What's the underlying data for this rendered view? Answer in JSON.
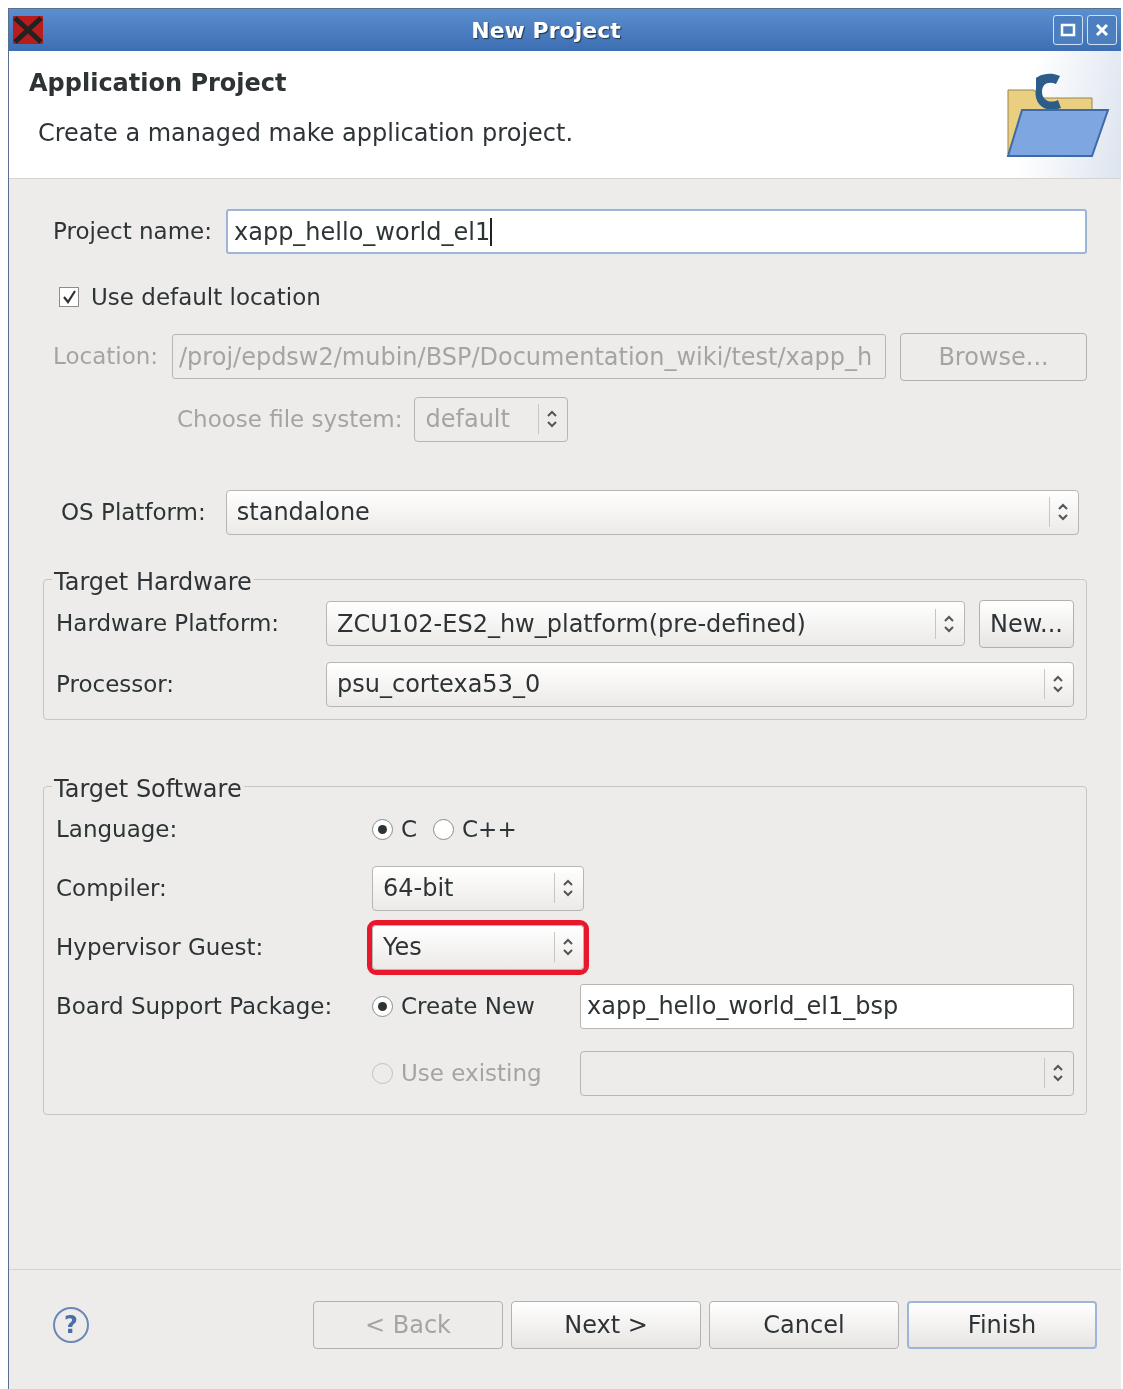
{
  "window": {
    "title": "New Project",
    "buttons": [
      {
        "kind": "maximize"
      },
      {
        "kind": "close"
      }
    ]
  },
  "header": {
    "title": "Application Project",
    "description": "Create a managed make application project."
  },
  "project_name": {
    "label": "Project name:",
    "value": "xapp_hello_world_el1",
    "focused": true
  },
  "use_default_location": {
    "label": "Use default location",
    "checked": true
  },
  "location": {
    "label": "Location:",
    "value": "/proj/epdsw2/mubin/BSP/Documentation_wiki/test/xapp_h",
    "disabled": true,
    "button": "Browse..."
  },
  "file_system": {
    "label": "Choose file system:",
    "value": "default",
    "disabled": true
  },
  "os_platform": {
    "label": "OS Platform:",
    "value": "standalone"
  },
  "target_hardware": {
    "title": "Target Hardware",
    "hardware_platform": {
      "label": "Hardware Platform:",
      "value": "ZCU102-ES2_hw_platform(pre-defined)",
      "button": "New..."
    },
    "processor": {
      "label": "Processor:",
      "value": "psu_cortexa53_0"
    }
  },
  "target_software": {
    "title": "Target Software",
    "language": {
      "label": "Language:",
      "options": [
        {
          "label": "C",
          "selected": true
        },
        {
          "label": "C++",
          "selected": false
        }
      ]
    },
    "compiler": {
      "label": "Compiler:",
      "value": "64-bit",
      "highlighted": false
    },
    "hypervisor_guest": {
      "label": "Hypervisor Guest:",
      "value": "Yes",
      "highlighted": true
    },
    "bsp": {
      "label": "Board Support Package:",
      "options": [
        {
          "label": "Create New",
          "selected": true,
          "disabled": false,
          "kind": "text",
          "value": "xapp_hello_world_el1_bsp"
        },
        {
          "label": "Use existing",
          "selected": false,
          "disabled": true,
          "kind": "select"
        }
      ]
    }
  },
  "footer": {
    "help": "?",
    "buttons": [
      {
        "label": "< Back",
        "disabled": true,
        "default": false
      },
      {
        "label": "Next >",
        "disabled": false,
        "default": false
      },
      {
        "label": "Cancel",
        "disabled": false,
        "default": false
      },
      {
        "label": "Finish",
        "disabled": false,
        "default": true
      }
    ]
  }
}
